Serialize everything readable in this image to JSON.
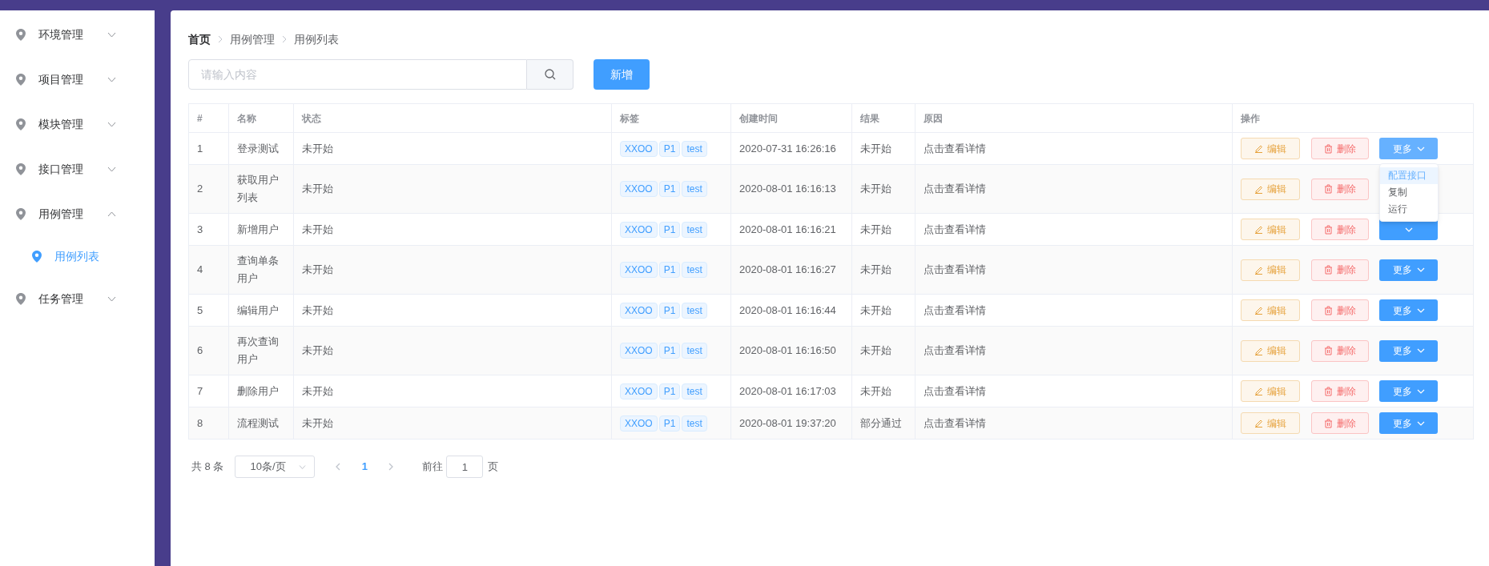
{
  "sidebar": {
    "items": [
      {
        "label": "环境管理",
        "expanded": false
      },
      {
        "label": "项目管理",
        "expanded": false
      },
      {
        "label": "模块管理",
        "expanded": false
      },
      {
        "label": "接口管理",
        "expanded": false
      },
      {
        "label": "用例管理",
        "expanded": true,
        "children": [
          {
            "label": "用例列表",
            "selected": true
          }
        ]
      },
      {
        "label": "任务管理",
        "expanded": false
      }
    ]
  },
  "breadcrumb": [
    {
      "label": "首页",
      "link": true
    },
    {
      "label": "用例管理",
      "link": false
    },
    {
      "label": "用例列表",
      "link": false
    }
  ],
  "search": {
    "placeholder": "请输入内容"
  },
  "add_button": "新增",
  "table": {
    "columns": [
      "#",
      "名称",
      "状态",
      "标签",
      "创建时间",
      "结果",
      "原因",
      "操作"
    ],
    "rows": [
      {
        "index": "1",
        "name": "登录测试",
        "status": "未开始",
        "tags": [
          "XXOO",
          "P1",
          "test"
        ],
        "created": "2020-07-31 16:26:16",
        "result": "未开始",
        "reason": "点击查看详情",
        "edit": "编辑",
        "delete": "删除",
        "more": "更多",
        "menu_open": true
      },
      {
        "index": "2",
        "name": "获取用户列表",
        "status": "未开始",
        "tags": [
          "XXOO",
          "P1",
          "test"
        ],
        "created": "2020-08-01 16:16:13",
        "result": "未开始",
        "reason": "点击查看详情",
        "edit": "编辑",
        "delete": "删除",
        "menu_open": false
      },
      {
        "index": "3",
        "name": "新增用户",
        "status": "未开始",
        "tags": [
          "XXOO",
          "P1",
          "test"
        ],
        "created": "2020-08-01 16:16:21",
        "result": "未开始",
        "reason": "点击查看详情",
        "edit": "编辑",
        "delete": "删除",
        "menu_open": false
      },
      {
        "index": "4",
        "name": "查询单条用户",
        "status": "未开始",
        "tags": [
          "XXOO",
          "P1",
          "test"
        ],
        "created": "2020-08-01 16:16:27",
        "result": "未开始",
        "reason": "点击查看详情",
        "edit": "编辑",
        "delete": "删除",
        "more": "更多",
        "menu_open": false
      },
      {
        "index": "5",
        "name": "编辑用户",
        "status": "未开始",
        "tags": [
          "XXOO",
          "P1",
          "test"
        ],
        "created": "2020-08-01 16:16:44",
        "result": "未开始",
        "reason": "点击查看详情",
        "edit": "编辑",
        "delete": "删除",
        "more": "更多",
        "menu_open": false
      },
      {
        "index": "6",
        "name": "再次查询用户",
        "status": "未开始",
        "tags": [
          "XXOO",
          "P1",
          "test"
        ],
        "created": "2020-08-01 16:16:50",
        "result": "未开始",
        "reason": "点击查看详情",
        "edit": "编辑",
        "delete": "删除",
        "more": "更多",
        "menu_open": false
      },
      {
        "index": "7",
        "name": "删除用户",
        "status": "未开始",
        "tags": [
          "XXOO",
          "P1",
          "test"
        ],
        "created": "2020-08-01 16:17:03",
        "result": "未开始",
        "reason": "点击查看详情",
        "edit": "编辑",
        "delete": "删除",
        "more": "更多",
        "menu_open": false
      },
      {
        "index": "8",
        "name": "流程测试",
        "status": "未开始",
        "tags": [
          "XXOO",
          "P1",
          "test"
        ],
        "created": "2020-08-01 19:37:20",
        "result": "部分通过",
        "reason": "点击查看详情",
        "edit": "编辑",
        "delete": "删除",
        "more": "更多",
        "menu_open": false
      }
    ]
  },
  "more_menu": {
    "items": [
      {
        "label": "配置接口",
        "selected": true
      },
      {
        "label": "复制",
        "selected": false
      },
      {
        "label": "运行",
        "selected": false
      }
    ]
  },
  "pagination": {
    "total": "共 8 条",
    "page_size": "10条/页",
    "pages": [
      {
        "label": "1",
        "selected": true
      }
    ],
    "goto_label": "前往",
    "goto_value": "1",
    "goto_suffix": "页"
  }
}
